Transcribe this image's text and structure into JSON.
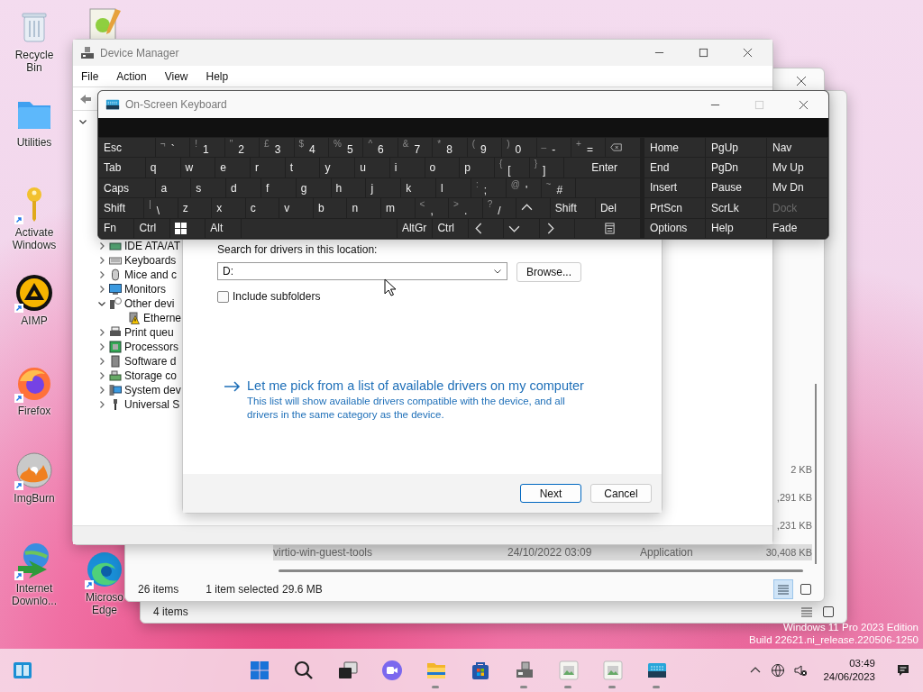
{
  "desktop_icons": [
    {
      "kind": "trash",
      "label": "Recycle Bin",
      "shortcut": false
    },
    {
      "kind": "folder",
      "label": "Utilities",
      "shortcut": false
    },
    {
      "kind": "key",
      "label": "Activate Windows",
      "shortcut": true
    },
    {
      "kind": "aimp",
      "label": "AIMP",
      "shortcut": true
    },
    {
      "kind": "firefox",
      "label": "Firefox",
      "shortcut": true
    },
    {
      "kind": "imgburn",
      "label": "ImgBurn",
      "shortcut": true
    },
    {
      "kind": "idm",
      "label": "Internet Downlo...",
      "shortcut": true
    },
    {
      "kind": "notepad",
      "shortcut": false
    },
    {
      "kind": "edge",
      "label": "Microso Edge",
      "shortcut": true
    }
  ],
  "explorer_back": {
    "status": "4 items"
  },
  "explorer_front": {
    "rows": [
      {
        "size": "2 KB",
        "selected": false
      },
      {
        "size": ",291 KB",
        "selected": false
      },
      {
        "size": ",231 KB",
        "selected": false
      },
      {
        "name": "virtio-win-guest-tools",
        "date": "24/10/2022 03:09",
        "type": "Application",
        "size": "30,408 KB",
        "selected": true
      }
    ],
    "status_count": "26 items",
    "status_selection": "1 item selected",
    "status_size": "29.6 MB"
  },
  "device_manager": {
    "title": "Device Manager",
    "menu": [
      "File",
      "Action",
      "View",
      "Help"
    ],
    "tree": {
      "expanded": true,
      "children": [
        {
          "kind": "ide",
          "label": "IDE ATA/AT",
          "expanded": false
        },
        {
          "kind": "keyboard",
          "label": "Keyboards",
          "expanded": false
        },
        {
          "kind": "mouse",
          "label": "Mice and c",
          "expanded": false
        },
        {
          "kind": "monitor",
          "label": "Monitors",
          "expanded": false
        },
        {
          "kind": "other",
          "label": "Other devi",
          "expanded": true,
          "children": [
            {
              "kind": "network",
              "label": "Etherne",
              "warning": true
            }
          ]
        },
        {
          "kind": "printer",
          "label": "Print queu",
          "expanded": false
        },
        {
          "kind": "processor",
          "label": "Processors",
          "expanded": false
        },
        {
          "kind": "software",
          "label": "Software d",
          "expanded": false
        },
        {
          "kind": "storage",
          "label": "Storage co",
          "expanded": false
        },
        {
          "kind": "system",
          "label": "System dev",
          "expanded": false
        },
        {
          "kind": "usb",
          "label": "Universal S",
          "expanded": false
        }
      ]
    }
  },
  "dialog": {
    "location_label": "Search for drivers in this location:",
    "path": "D:",
    "browse": "Browse...",
    "include_subfolders": {
      "label": "Include subfolders",
      "checked": false
    },
    "pick_link": "Let me pick from a list of available drivers on my computer",
    "pick_description": "This list will show available drivers compatible with the device, and all drivers in the same category as the device.",
    "buttons": [
      {
        "label": "Next",
        "default": true
      },
      {
        "label": "Cancel",
        "default": false
      }
    ]
  },
  "keyboard": {
    "title": "On-Screen Keyboard",
    "rows": [
      {
        "keys": [
          {
            "kind": "mod",
            "label": "Esc"
          },
          {
            "kind": "dual",
            "shift": "¬",
            "main": "`"
          },
          {
            "kind": "dual",
            "shift": "!",
            "main": "1"
          },
          {
            "kind": "dual",
            "shift": "\"",
            "main": "2"
          },
          {
            "kind": "dual",
            "shift": "£",
            "main": "3"
          },
          {
            "kind": "dual",
            "shift": "$",
            "main": "4"
          },
          {
            "kind": "dual",
            "shift": "%",
            "main": "5"
          },
          {
            "kind": "dual",
            "shift": "^",
            "main": "6"
          },
          {
            "kind": "dual",
            "shift": "&",
            "main": "7"
          },
          {
            "kind": "dual",
            "shift": "*",
            "main": "8"
          },
          {
            "kind": "dual",
            "shift": "(",
            "main": "9"
          },
          {
            "kind": "dual",
            "shift": ")",
            "main": "0"
          },
          {
            "kind": "dual",
            "shift": "_",
            "main": "-"
          },
          {
            "kind": "dual",
            "shift": "+",
            "main": "="
          },
          {
            "kind": "backspace"
          }
        ]
      },
      {
        "keys": [
          {
            "kind": "mod",
            "label": "Tab"
          },
          {
            "kind": "char",
            "label": "q"
          },
          {
            "kind": "char",
            "label": "w"
          },
          {
            "kind": "char",
            "label": "e"
          },
          {
            "kind": "char",
            "label": "r"
          },
          {
            "kind": "char",
            "label": "t"
          },
          {
            "kind": "char",
            "label": "y"
          },
          {
            "kind": "char",
            "label": "u"
          },
          {
            "kind": "char",
            "label": "i"
          },
          {
            "kind": "char",
            "label": "o"
          },
          {
            "kind": "char",
            "label": "p"
          },
          {
            "kind": "dual",
            "shift": "{",
            "main": "["
          },
          {
            "kind": "dual",
            "shift": "}",
            "main": "]"
          },
          {
            "kind": "enter",
            "label": "Enter"
          }
        ]
      },
      {
        "keys": [
          {
            "kind": "mod",
            "label": "Caps"
          },
          {
            "kind": "char",
            "label": "a"
          },
          {
            "kind": "char",
            "label": "s"
          },
          {
            "kind": "char",
            "label": "d"
          },
          {
            "kind": "char",
            "label": "f"
          },
          {
            "kind": "char",
            "label": "g"
          },
          {
            "kind": "char",
            "label": "h"
          },
          {
            "kind": "char",
            "label": "j"
          },
          {
            "kind": "char",
            "label": "k"
          },
          {
            "kind": "char",
            "label": "l"
          },
          {
            "kind": "dual",
            "shift": ":",
            "main": ";"
          },
          {
            "kind": "dual",
            "shift": "@",
            "main": "'"
          },
          {
            "kind": "dual",
            "shift": "~",
            "main": "#"
          },
          {
            "kind": "blank"
          }
        ]
      },
      {
        "keys": [
          {
            "kind": "mod",
            "label": "Shift"
          },
          {
            "kind": "dual",
            "shift": "|",
            "main": "\\"
          },
          {
            "kind": "char",
            "label": "z"
          },
          {
            "kind": "char",
            "label": "x"
          },
          {
            "kind": "char",
            "label": "c"
          },
          {
            "kind": "char",
            "label": "v"
          },
          {
            "kind": "char",
            "label": "b"
          },
          {
            "kind": "char",
            "label": "n"
          },
          {
            "kind": "char",
            "label": "m"
          },
          {
            "kind": "dual",
            "shift": "<",
            "main": ","
          },
          {
            "kind": "dual",
            "shift": ">",
            "main": "."
          },
          {
            "kind": "dual",
            "shift": "?",
            "main": "/"
          },
          {
            "kind": "up"
          },
          {
            "kind": "mod",
            "label": "Shift"
          },
          {
            "kind": "mod",
            "label": "Del"
          }
        ]
      },
      {
        "keys": [
          {
            "kind": "mod",
            "label": "Fn"
          },
          {
            "kind": "mod",
            "label": "Ctrl"
          },
          {
            "kind": "windows"
          },
          {
            "kind": "mod",
            "label": "Alt"
          },
          {
            "kind": "space"
          },
          {
            "kind": "mod",
            "label": "AltGr"
          },
          {
            "kind": "mod",
            "label": "Ctrl"
          },
          {
            "kind": "left"
          },
          {
            "kind": "down"
          },
          {
            "kind": "right"
          },
          {
            "kind": "menu"
          }
        ]
      }
    ],
    "nav_keys": [
      {
        "label": "Home",
        "disabled": false
      },
      {
        "label": "PgUp",
        "disabled": false
      },
      {
        "label": "Nav",
        "disabled": false
      },
      {
        "label": "End",
        "disabled": false
      },
      {
        "label": "PgDn",
        "disabled": false
      },
      {
        "label": "Mv Up",
        "disabled": false
      },
      {
        "label": "Insert",
        "disabled": false
      },
      {
        "label": "Pause",
        "disabled": false
      },
      {
        "label": "Mv Dn",
        "disabled": false
      },
      {
        "label": "PrtScn",
        "disabled": false
      },
      {
        "label": "ScrLk",
        "disabled": false
      },
      {
        "label": "Dock",
        "disabled": true
      },
      {
        "label": "Options",
        "disabled": false
      },
      {
        "label": "Help",
        "disabled": false
      },
      {
        "label": "Fade",
        "disabled": false
      }
    ]
  },
  "edition": "Windows 11 Pro 2023 Edition",
  "build": "Build 22621.ni_release.220506-1250",
  "taskbar": {
    "apps": [
      {
        "kind": "start",
        "running": false
      },
      {
        "kind": "search",
        "running": false
      },
      {
        "kind": "taskview",
        "running": false
      },
      {
        "kind": "video",
        "running": false
      },
      {
        "kind": "explorer",
        "running": true
      },
      {
        "kind": "store",
        "running": false
      },
      {
        "kind": "devmgr",
        "running": true
      },
      {
        "kind": "picture",
        "running": true
      },
      {
        "kind": "picture",
        "running": true
      },
      {
        "kind": "keyboard",
        "running": true
      }
    ],
    "time": "03:49",
    "date": "24/06/2023"
  }
}
